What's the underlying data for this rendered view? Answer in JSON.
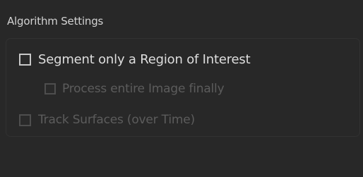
{
  "section": {
    "title": "Algorithm Settings"
  },
  "options": [
    {
      "label": "Segment only a Region of Interest",
      "checked": false,
      "enabled": true
    },
    {
      "label": "Process entire Image finally",
      "checked": false,
      "enabled": false
    },
    {
      "label": "Track Surfaces (over Time)",
      "checked": false,
      "enabled": false
    }
  ],
  "colors": {
    "background": "#282828",
    "text_enabled": "#dedede",
    "text_disabled": "#5c5c5c",
    "title": "#d2d2d2"
  }
}
